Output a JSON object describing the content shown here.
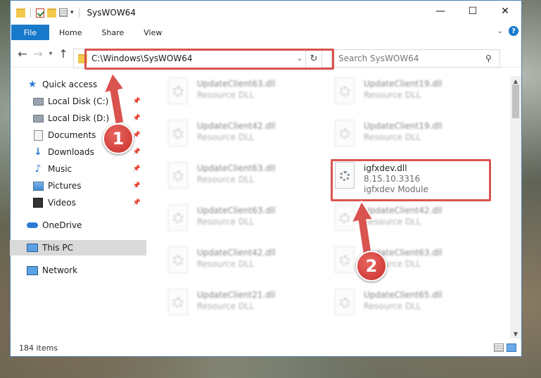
{
  "window": {
    "title": "SysWOW64",
    "min_glyph": "—",
    "max_glyph": "☐",
    "close_glyph": "✕"
  },
  "ribbon": {
    "tabs": [
      "File",
      "Home",
      "Share",
      "View"
    ],
    "help": "?"
  },
  "address": {
    "path": "C:\\Windows\\SysWOW64"
  },
  "search": {
    "placeholder": "Search SysWOW64"
  },
  "sidebar": {
    "items": [
      {
        "label": "Quick access",
        "icon": "star-icon"
      },
      {
        "label": "Local Disk (C:)",
        "icon": "drive-icon",
        "pinned": true
      },
      {
        "label": "Local Disk (D:)",
        "icon": "drive-icon",
        "pinned": true
      },
      {
        "label": "Documents",
        "icon": "documents-icon",
        "pinned": true
      },
      {
        "label": "Downloads",
        "icon": "download-icon",
        "pinned": true
      },
      {
        "label": "Music",
        "icon": "music-icon",
        "pinned": true
      },
      {
        "label": "Pictures",
        "icon": "pictures-icon",
        "pinned": true
      },
      {
        "label": "Videos",
        "icon": "video-icon",
        "pinned": true
      },
      {
        "label": "OneDrive",
        "icon": "cloud-icon"
      },
      {
        "label": "This PC",
        "icon": "computer-icon",
        "selected": true
      },
      {
        "label": "Network",
        "icon": "network-icon"
      }
    ]
  },
  "files": [
    {
      "name": "UpdateClient63.dll",
      "desc": "Resource DLL",
      "col": 0,
      "row": 0
    },
    {
      "name": "UpdateClient19.dll",
      "desc": "Resource DLL",
      "col": 1,
      "row": 0
    },
    {
      "name": "UpdateClient42.dll",
      "desc": "Resource DLL",
      "col": 0,
      "row": 1
    },
    {
      "name": "UpdateClient19.dll",
      "desc": "Resource DLL",
      "col": 1,
      "row": 1
    },
    {
      "name": "UpdateClient63.dll",
      "desc": "Resource DLL",
      "col": 0,
      "row": 2
    },
    {
      "name": "igfxdev.dll",
      "desc": "8.15.10.3316",
      "desc2": "igfxdev Module",
      "col": 1,
      "row": 2,
      "highlight": true
    },
    {
      "name": "UpdateClient63.dll",
      "desc": "Resource DLL",
      "col": 0,
      "row": 3
    },
    {
      "name": "UpdateClient42.dll",
      "desc": "Resource DLL",
      "col": 1,
      "row": 3
    },
    {
      "name": "UpdateClient42.dll",
      "desc": "Resource DLL",
      "col": 0,
      "row": 4
    },
    {
      "name": "UpdateClient63.dll",
      "desc": "Resource DLL",
      "col": 1,
      "row": 4
    },
    {
      "name": "UpdateClient21.dll",
      "desc": "Resource DLL",
      "col": 0,
      "row": 5
    },
    {
      "name": "UpdateClient65.dll",
      "desc": "Resource DLL",
      "col": 1,
      "row": 5
    }
  ],
  "status": {
    "count": "184 items"
  },
  "annotations": {
    "step1": "1",
    "step2": "2",
    "color": "#d9534f"
  }
}
